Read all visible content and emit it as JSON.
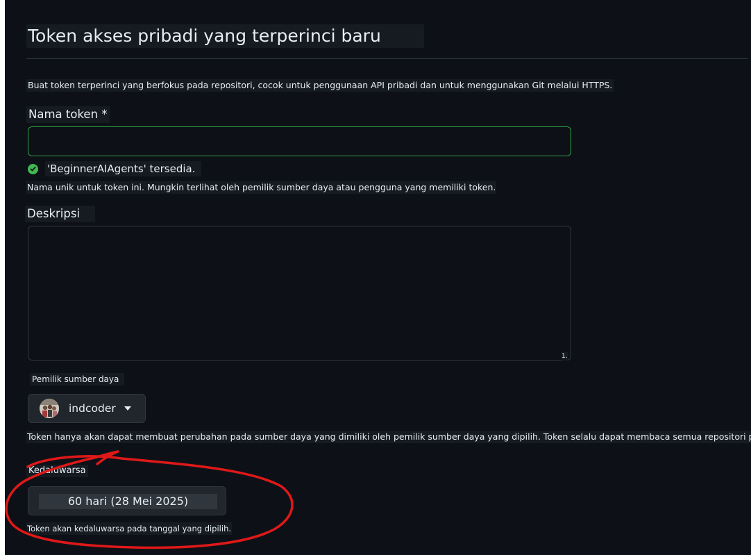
{
  "page": {
    "title": "Token akses pribadi yang terperinci baru",
    "intro": "Buat token terperinci yang berfokus pada repositori, cocok untuk penggunaan API pribadi dan untuk menggunakan Git melalui HTTPS."
  },
  "token_name": {
    "label": "Nama token *",
    "value": "",
    "availability": "'BeginnerAIAgents' tersedia.",
    "note": "Nama unik untuk token ini. Mungkin terlihat oleh pemilik sumber daya atau pengguna yang memiliki token."
  },
  "description": {
    "label": "Deskripsi",
    "value": "",
    "resize_mark": "1."
  },
  "resource_owner": {
    "label": "Pemilik sumber daya",
    "selected": "indcoder",
    "note": "Token hanya akan dapat membuat perubahan pada sumber daya yang dimiliki oleh pemilik sumber daya yang dipilih. Token selalu dapat membaca semua repositori publik."
  },
  "expiration": {
    "label": "Kedaluwarsa",
    "selected": "60 hari (28 Mei 2025)",
    "note": "Token akan kedaluwarsa pada tanggal yang dipilih."
  },
  "colors": {
    "background": "#0d1117",
    "success": "#3fb950",
    "annotation": "#e01818"
  },
  "icons": [
    "check-circle-icon",
    "chevron-down-icon",
    "avatar"
  ]
}
